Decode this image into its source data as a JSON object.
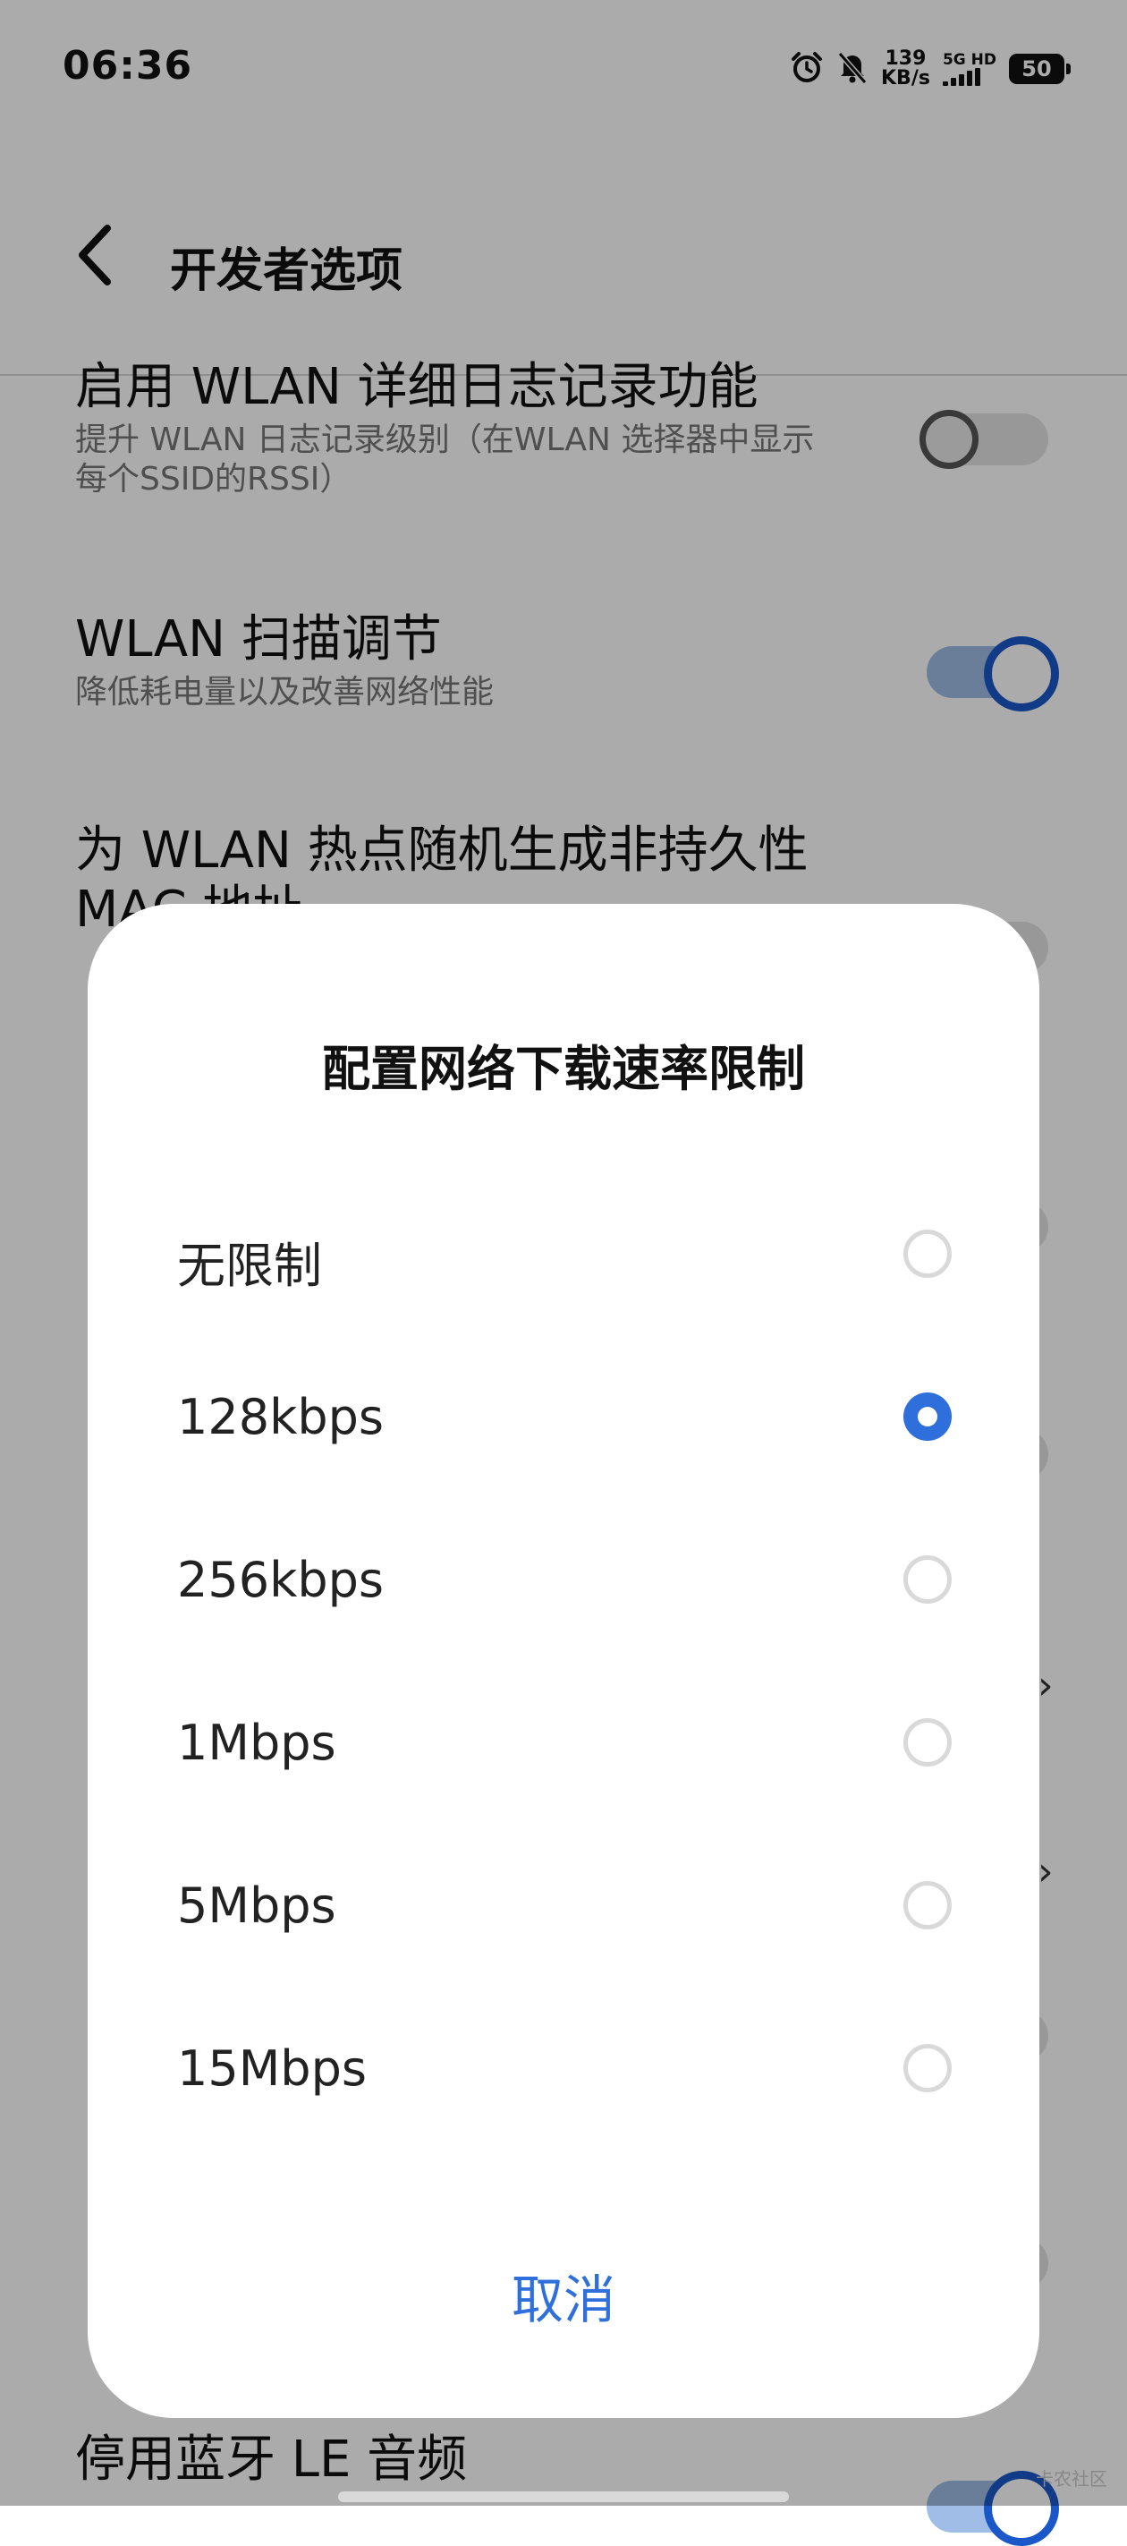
{
  "status_bar": {
    "time": "06:36",
    "net_speed_value": "139",
    "net_speed_unit": "KB/s",
    "signal_label": "5G HD",
    "battery": "50",
    "icons": [
      "alarm-icon",
      "mute-icon",
      "signal-icon",
      "battery-icon"
    ]
  },
  "header": {
    "title": "开发者选项",
    "back_icon": "back-icon"
  },
  "settings": [
    {
      "title": "启用 WLAN 详细日志记录功能",
      "subtitle_line1": "提升 WLAN 日志记录级别（在WLAN 选择器中显示",
      "subtitle_line2": "每个SSID的RSSI）",
      "toggle": "off"
    },
    {
      "title": "WLAN 扫描调节",
      "subtitle": "降低耗电量以及改善网络性能",
      "toggle": "on"
    },
    {
      "title_line1": "为 WLAN 热点随机生成非持久性",
      "title_line2": "MAC 地址"
    },
    {
      "title": "停用蓝牙 LE 音频",
      "toggle": "on"
    }
  ],
  "dialog": {
    "title": "配置网络下载速率限制",
    "options": [
      {
        "label": "无限制",
        "selected": false
      },
      {
        "label": "128kbps",
        "selected": true
      },
      {
        "label": "256kbps",
        "selected": false
      },
      {
        "label": "1Mbps",
        "selected": false
      },
      {
        "label": "5Mbps",
        "selected": false
      },
      {
        "label": "15Mbps",
        "selected": false
      }
    ],
    "cancel_label": "取消"
  },
  "watermark": "卡农社区",
  "colors": {
    "accent": "#2e6fdc",
    "scrim": "#000000"
  }
}
